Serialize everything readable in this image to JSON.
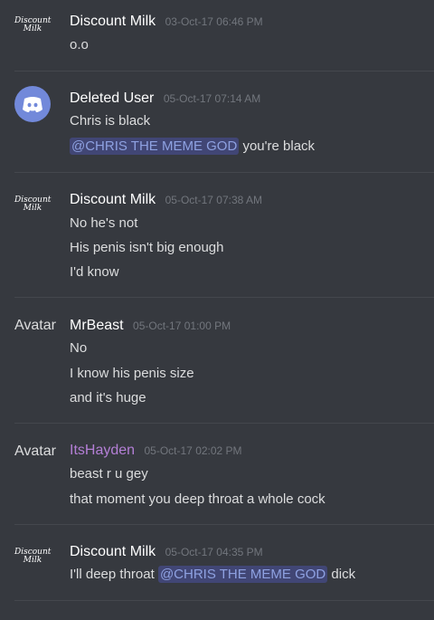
{
  "messages": [
    {
      "avatar": "discount-milk-logo",
      "logo_text": [
        "Discount",
        "Milk"
      ],
      "username": "Discount Milk",
      "timestamp": "03-Oct-17 06:46 PM",
      "lines": [
        "o.o"
      ]
    },
    {
      "avatar": "discord-logo-icon",
      "username": "Deleted User",
      "timestamp": "05-Oct-17 07:14 AM",
      "lines": [
        "Chris is black"
      ],
      "mention_line": {
        "mention": "@CHRIS THE MEME GOD",
        "after": "you're black"
      }
    },
    {
      "avatar": "discount-milk-logo",
      "logo_text": [
        "Discount",
        "Milk"
      ],
      "username": "Discount Milk",
      "timestamp": "05-Oct-17 07:38 AM",
      "lines": [
        "No he's not",
        "His penis isn't big enough",
        "I'd know"
      ]
    },
    {
      "avatar_text": "Avatar",
      "username": "MrBeast",
      "timestamp": "05-Oct-17 01:00 PM",
      "lines": [
        "No",
        "I know his penis size",
        "and it's huge"
      ]
    },
    {
      "avatar_text": "Avatar",
      "username": "ItsHayden",
      "username_color": "#b47fd6",
      "timestamp": "05-Oct-17 02:02 PM",
      "lines": [
        "beast r u gey",
        "that moment you deep throat a whole cock"
      ]
    },
    {
      "avatar": "discount-milk-logo",
      "logo_text": [
        "Discount",
        "Milk"
      ],
      "username": "Discount Milk",
      "timestamp": "05-Oct-17 04:35 PM",
      "mention_line": {
        "before": "I'll deep throat",
        "mention": "@CHRIS THE MEME GOD",
        "after": "dick"
      }
    }
  ],
  "colors": {
    "background": "#36393f",
    "mention_bg": "#414675",
    "mention_text": "#8ea1e1",
    "discord_blurple": "#7289da"
  }
}
